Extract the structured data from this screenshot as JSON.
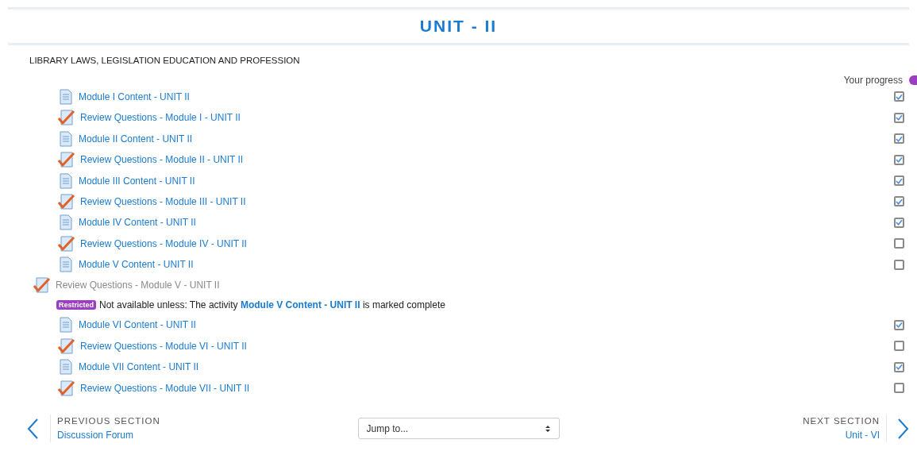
{
  "section": {
    "title": "UNIT - II",
    "summary": "LIBRARY LAWS, LEGISLATION EDUCATION AND PROFESSION"
  },
  "progress_label": "Your progress",
  "activities": [
    {
      "kind": "page",
      "name": "Module I Content - UNIT II",
      "available": true,
      "checked": true
    },
    {
      "kind": "quiz",
      "name": "Review Questions - Module I - UNIT II",
      "available": true,
      "checked": true
    },
    {
      "kind": "page",
      "name": "Module II Content - UNIT II",
      "available": true,
      "checked": true
    },
    {
      "kind": "quiz",
      "name": "Review Questions - Module II - UNIT II",
      "available": true,
      "checked": true
    },
    {
      "kind": "page",
      "name": "Module III Content - UNIT II",
      "available": true,
      "checked": true
    },
    {
      "kind": "quiz",
      "name": "Review Questions - Module III - UNIT II",
      "available": true,
      "checked": true
    },
    {
      "kind": "page",
      "name": "Module IV Content - UNIT II",
      "available": true,
      "checked": true
    },
    {
      "kind": "quiz",
      "name": "Review Questions - Module IV - UNIT II",
      "available": true,
      "checked": false
    },
    {
      "kind": "page",
      "name": "Module V Content - UNIT II",
      "available": true,
      "checked": false
    },
    {
      "kind": "quiz",
      "name": "Review Questions - Module V - UNIT II",
      "available": false,
      "restriction": {
        "badge": "Restricted",
        "before": "Not available unless: The activity ",
        "link": "Module V Content - UNIT II",
        "after": " is marked complete"
      }
    },
    {
      "kind": "page",
      "name": "Module VI Content - UNIT II",
      "available": true,
      "checked": true
    },
    {
      "kind": "quiz",
      "name": "Review Questions - Module VI - UNIT II",
      "available": true,
      "checked": false
    },
    {
      "kind": "page",
      "name": "Module VII Content - UNIT II",
      "available": true,
      "checked": true
    },
    {
      "kind": "quiz",
      "name": "Review Questions - Module VII - UNIT II",
      "available": true,
      "checked": false
    }
  ],
  "footer": {
    "previous": {
      "label": "PREVIOUS SECTION",
      "link": "Discussion Forum"
    },
    "jump": {
      "value": "Jump to..."
    },
    "next": {
      "label": "NEXT SECTION",
      "link": "Unit - VI"
    }
  }
}
